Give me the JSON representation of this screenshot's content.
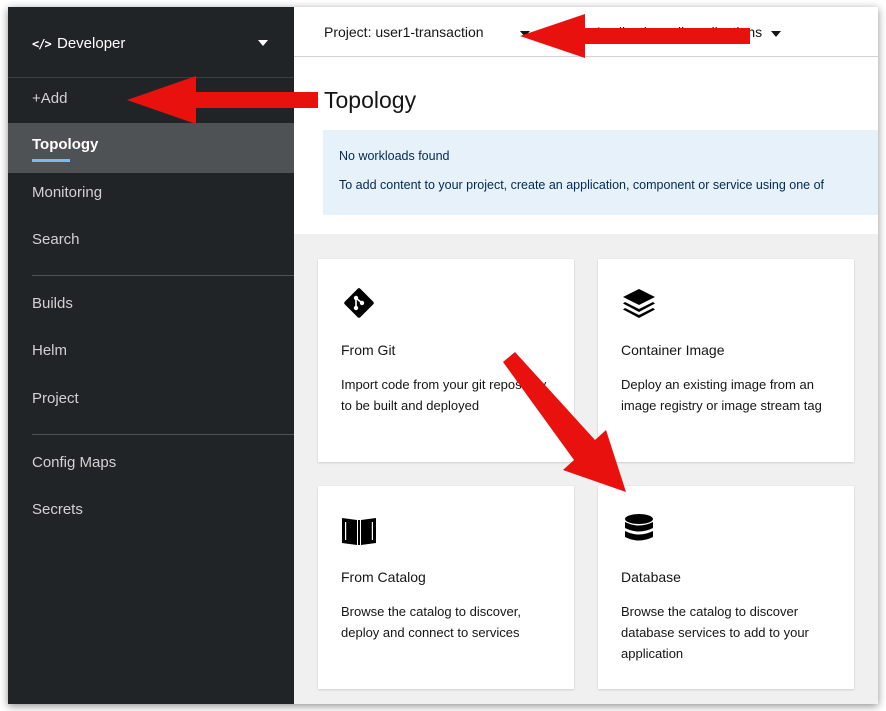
{
  "colors": {
    "sidebar_bg": "#212427",
    "active_nav_bg": "#4f5255",
    "active_underline": "#73bcf7",
    "alert_bg": "#e7f1fa",
    "annotation_arrow": "#e8110e"
  },
  "sidebar": {
    "perspective": {
      "icon": "code-icon",
      "icon_glyph": "</>",
      "label": "Developer"
    },
    "items": [
      {
        "label": "+Add"
      },
      {
        "label": "Topology",
        "active": true
      },
      {
        "label": "Monitoring"
      },
      {
        "label": "Search"
      },
      {
        "label": "Builds"
      },
      {
        "label": "Helm"
      },
      {
        "label": "Project"
      },
      {
        "label": "Config Maps"
      },
      {
        "label": "Secrets"
      }
    ]
  },
  "topbar": {
    "project_label": "Project: user1-transaction",
    "application_label": "Application: all applications"
  },
  "page": {
    "title": "Topology",
    "alert_title": "No workloads found",
    "alert_body": "To add content to your project, create an application, component or service using one of"
  },
  "cards": [
    {
      "icon": "git-icon",
      "title": "From Git",
      "description": "Import code from your git repository to be built and deployed"
    },
    {
      "icon": "container-image-icon",
      "title": "Container Image",
      "description": "Deploy an existing image from an image registry or image stream tag"
    },
    {
      "icon": "catalog-book-icon",
      "title": "From Catalog",
      "description": "Browse the catalog to discover, deploy and connect to services"
    },
    {
      "icon": "database-icon",
      "title": "Database",
      "description": "Browse the catalog to discover database services to add to your application"
    }
  ]
}
